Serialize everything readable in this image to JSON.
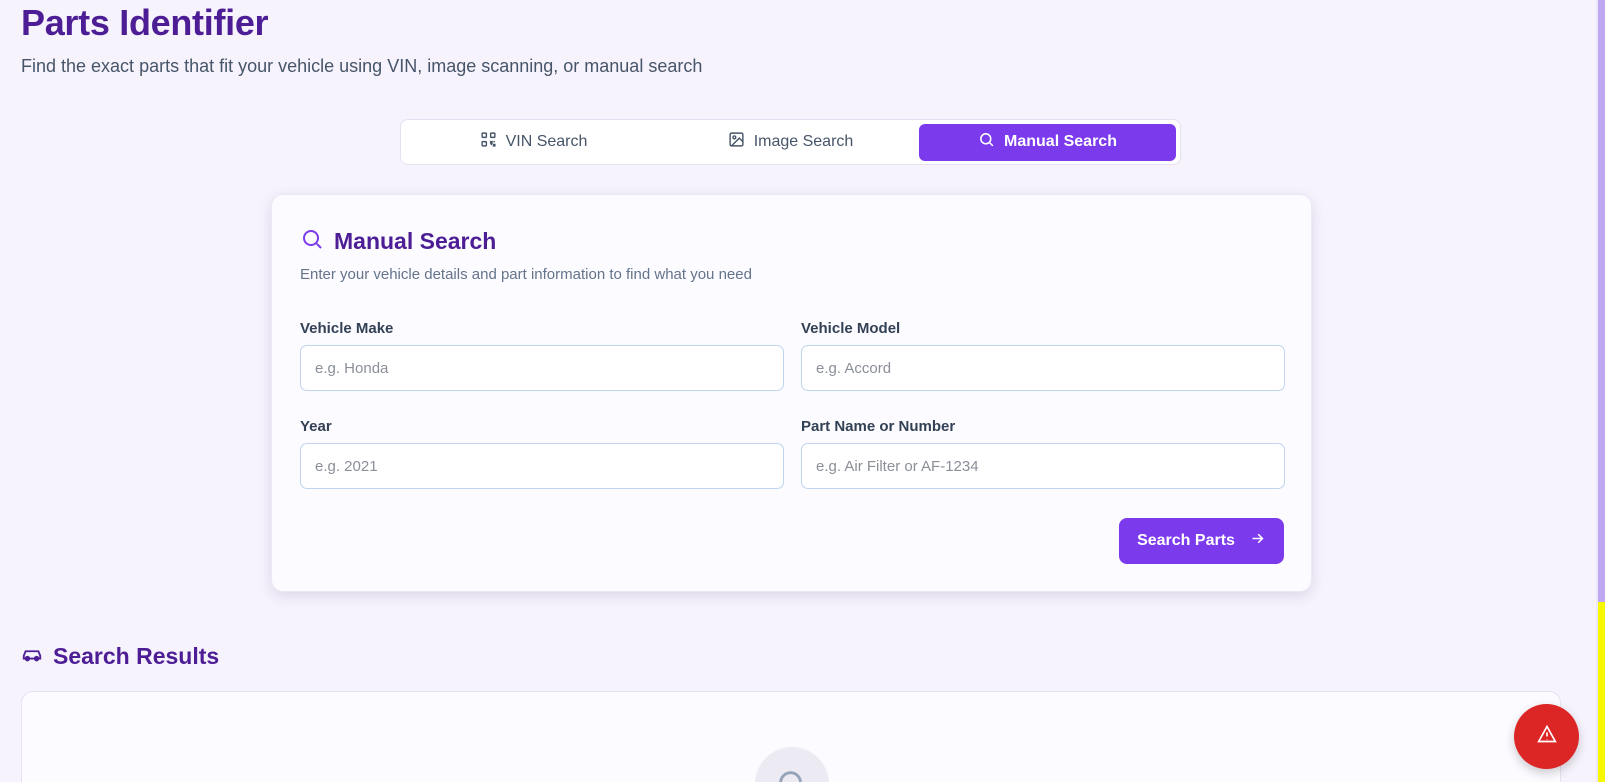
{
  "header": {
    "title": "Parts Identifier",
    "subtitle": "Find the exact parts that fit your vehicle using VIN, image scanning, or manual search"
  },
  "tabs": [
    {
      "label": "VIN Search",
      "icon": "qr-code-icon",
      "active": false
    },
    {
      "label": "Image Search",
      "icon": "image-icon",
      "active": false
    },
    {
      "label": "Manual Search",
      "icon": "search-icon",
      "active": true
    }
  ],
  "manual_search": {
    "title": "Manual Search",
    "description": "Enter your vehicle details and part information to find what you need",
    "fields": {
      "make": {
        "label": "Vehicle Make",
        "placeholder": "e.g. Honda",
        "value": ""
      },
      "model": {
        "label": "Vehicle Model",
        "placeholder": "e.g. Accord",
        "value": ""
      },
      "year": {
        "label": "Year",
        "placeholder": "e.g. 2021",
        "value": ""
      },
      "part": {
        "label": "Part Name or Number",
        "placeholder": "e.g. Air Filter or AF-1234",
        "value": ""
      }
    },
    "submit_label": "Search Parts"
  },
  "results": {
    "title": "Search Results",
    "icon": "car-icon"
  },
  "colors": {
    "accent": "#7c3aed",
    "heading": "#4c1d95",
    "alert": "#dc2626",
    "background": "#f6f3fd"
  }
}
